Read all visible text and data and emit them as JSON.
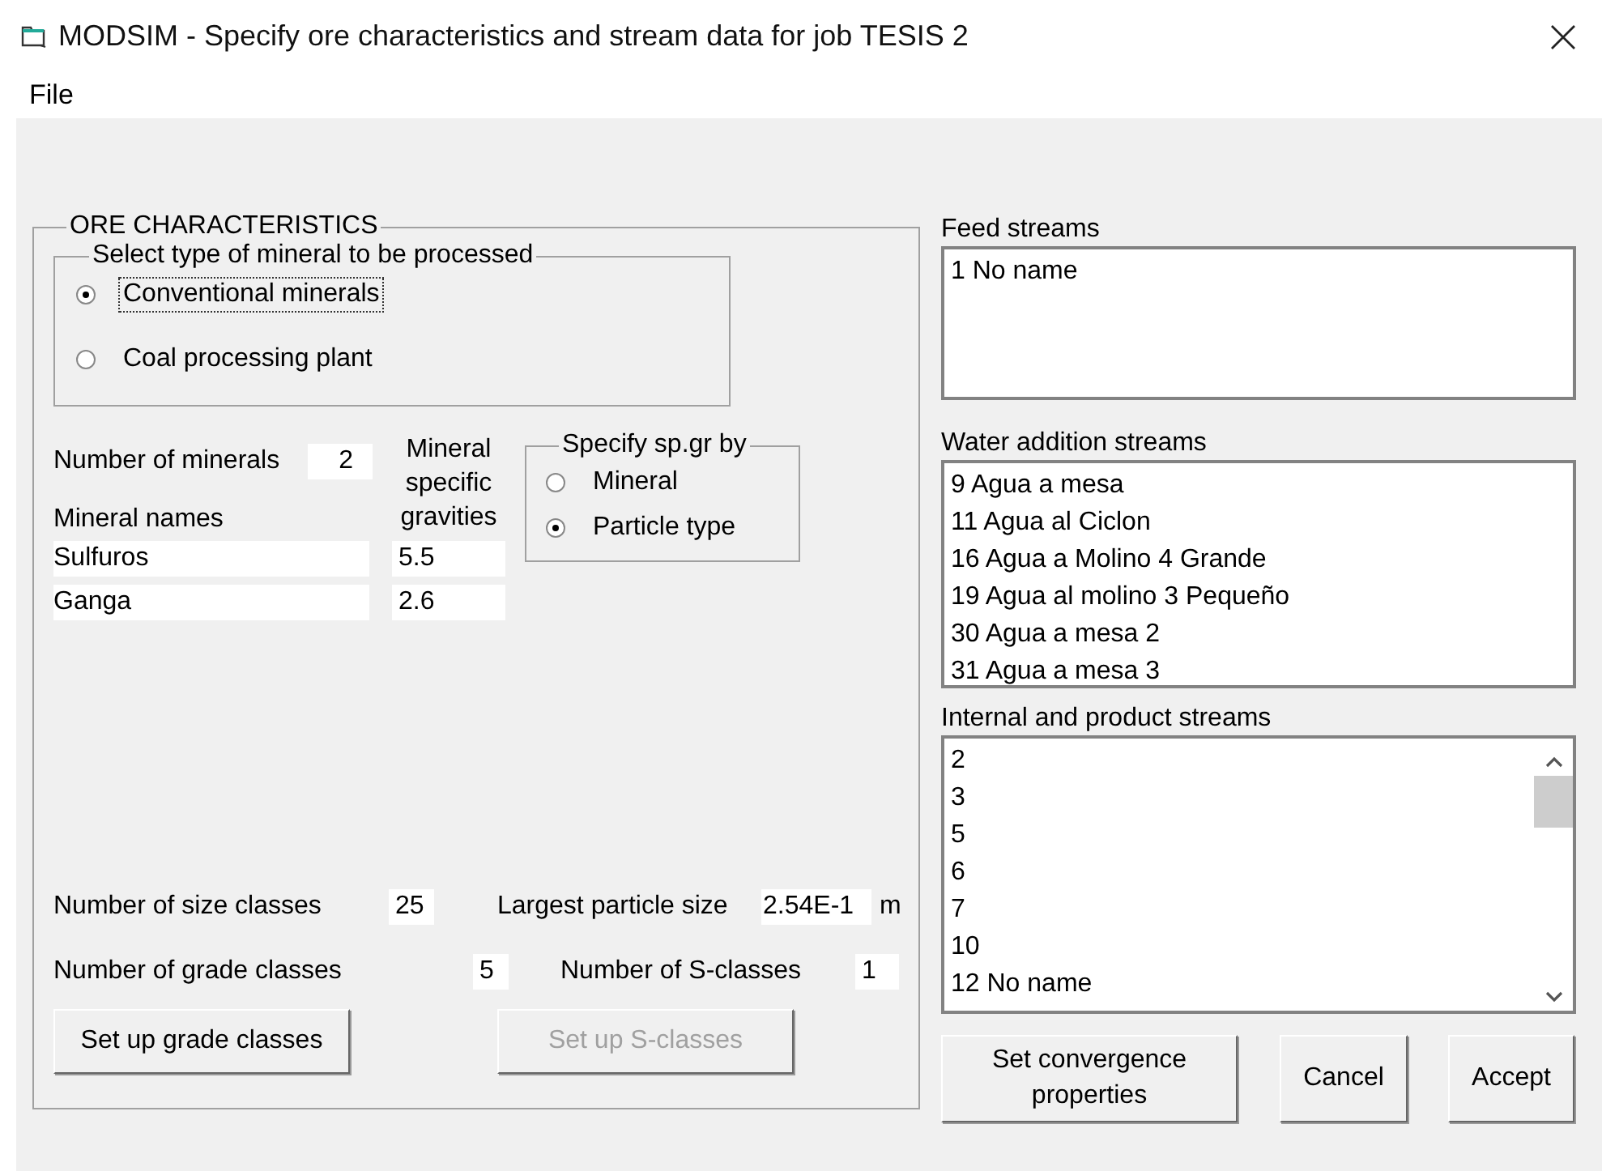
{
  "window": {
    "title": "MODSIM - Specify ore characteristics and stream data for job TESIS 2"
  },
  "menu": [
    "File"
  ],
  "ore_characteristics": {
    "title": "ORE CHARACTERISTICS",
    "mineral_type": {
      "title": "Select type of mineral to be processed",
      "options": [
        {
          "label": "Conventional minerals",
          "selected": true,
          "focused": true
        },
        {
          "label": "Coal processing plant",
          "selected": false,
          "focused": false
        }
      ]
    },
    "number_of_minerals": {
      "label": "Number of minerals",
      "value": "2"
    },
    "names_label": "Mineral names",
    "gravities_label": "Mineral specific gravities",
    "minerals": [
      {
        "name": "Sulfuros",
        "specific_gravity": "5.5"
      },
      {
        "name": "Ganga",
        "specific_gravity": "2.6"
      }
    ],
    "spgr_by": {
      "title": "Specify sp.gr by",
      "options": [
        {
          "label": "Mineral",
          "selected": false,
          "focused": false
        },
        {
          "label": "Particle type",
          "selected": true,
          "focused": false
        }
      ]
    },
    "size_classes": {
      "label": "Number of size classes",
      "value": "25"
    },
    "largest_particle_size": {
      "label": "Largest particle size",
      "value": "2.54E-1",
      "unit": "m"
    },
    "grade_classes": {
      "label": "Number of grade classes",
      "value": "5"
    },
    "s_classes": {
      "label": "Number of S-classes",
      "value": "1"
    },
    "buttons": [
      {
        "label": "Set up grade classes",
        "disabled": false
      },
      {
        "label": "Set up S-classes",
        "disabled": true
      }
    ]
  },
  "streams": [
    {
      "title": "Feed streams",
      "scrollbar": false,
      "items": [
        "1 No name"
      ]
    },
    {
      "title": "Water addition streams",
      "scrollbar": false,
      "items": [
        "9 Agua a mesa",
        "11 Agua al Ciclon",
        "16 Agua a Molino 4 Grande",
        "19 Agua al molino 3 Pequeño",
        "30 Agua a mesa 2",
        "31 Agua a mesa 3"
      ]
    },
    {
      "title": "Internal and product streams",
      "scrollbar": true,
      "items": [
        "2",
        "3",
        "5",
        "6",
        "7",
        "10",
        "12 No name"
      ]
    }
  ],
  "buttons": [
    {
      "label": "Set convergence properties"
    },
    {
      "label": "Cancel"
    },
    {
      "label": "Accept"
    }
  ]
}
